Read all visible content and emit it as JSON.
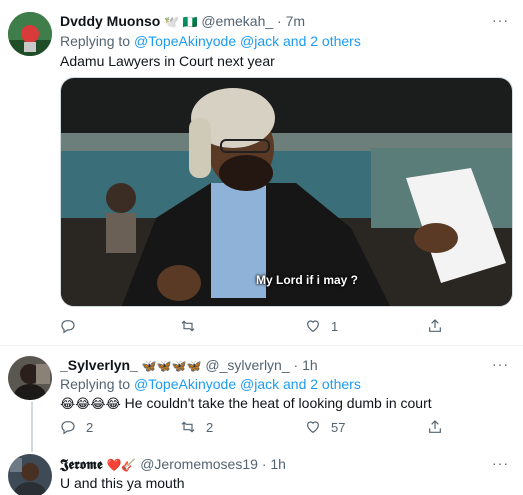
{
  "tweet1": {
    "name": "Dvddy Muonso",
    "name_emojis": "🕊️ 🇳🇬",
    "handle": "@emekah_",
    "dot": "·",
    "time": "7m",
    "replying_prefix": "Replying to",
    "replying_user": "@TopeAkinyode",
    "replying_rest": "@jack and 2 others",
    "text": "Adamu Lawyers in Court next year",
    "media_caption": "My Lord if i may ?",
    "reply_count": "",
    "retweet_count": "",
    "like_count": "1",
    "more": "···"
  },
  "tweet2": {
    "name": "_Sylverlyn_",
    "name_emojis": "🦋🦋🦋🦋",
    "handle": "@_sylverlyn_",
    "dot": "·",
    "time": "1h",
    "replying_prefix": "Replying to",
    "replying_user": "@TopeAkinyode",
    "replying_rest": "@jack and 2 others",
    "text_emojis": "😂😂😂😂",
    "text": "He couldn't take the heat of looking dumb in court",
    "reply_count": "2",
    "retweet_count": "2",
    "like_count": "57",
    "more": "···"
  },
  "tweet3": {
    "name": "𝕵𝖊𝖗𝖔𝖒𝖊",
    "name_emojis": "❤️🎸",
    "handle": "@Jeromemoses19",
    "dot": "·",
    "time": "1h",
    "text": "U and this ya mouth",
    "more": "···"
  },
  "icons": {
    "reply": "reply-icon",
    "retweet": "retweet-icon",
    "like": "heart-icon",
    "share": "share-icon"
  },
  "colors": {
    "link": "#1d9bf0",
    "muted": "#536471",
    "text": "#0f1419"
  }
}
